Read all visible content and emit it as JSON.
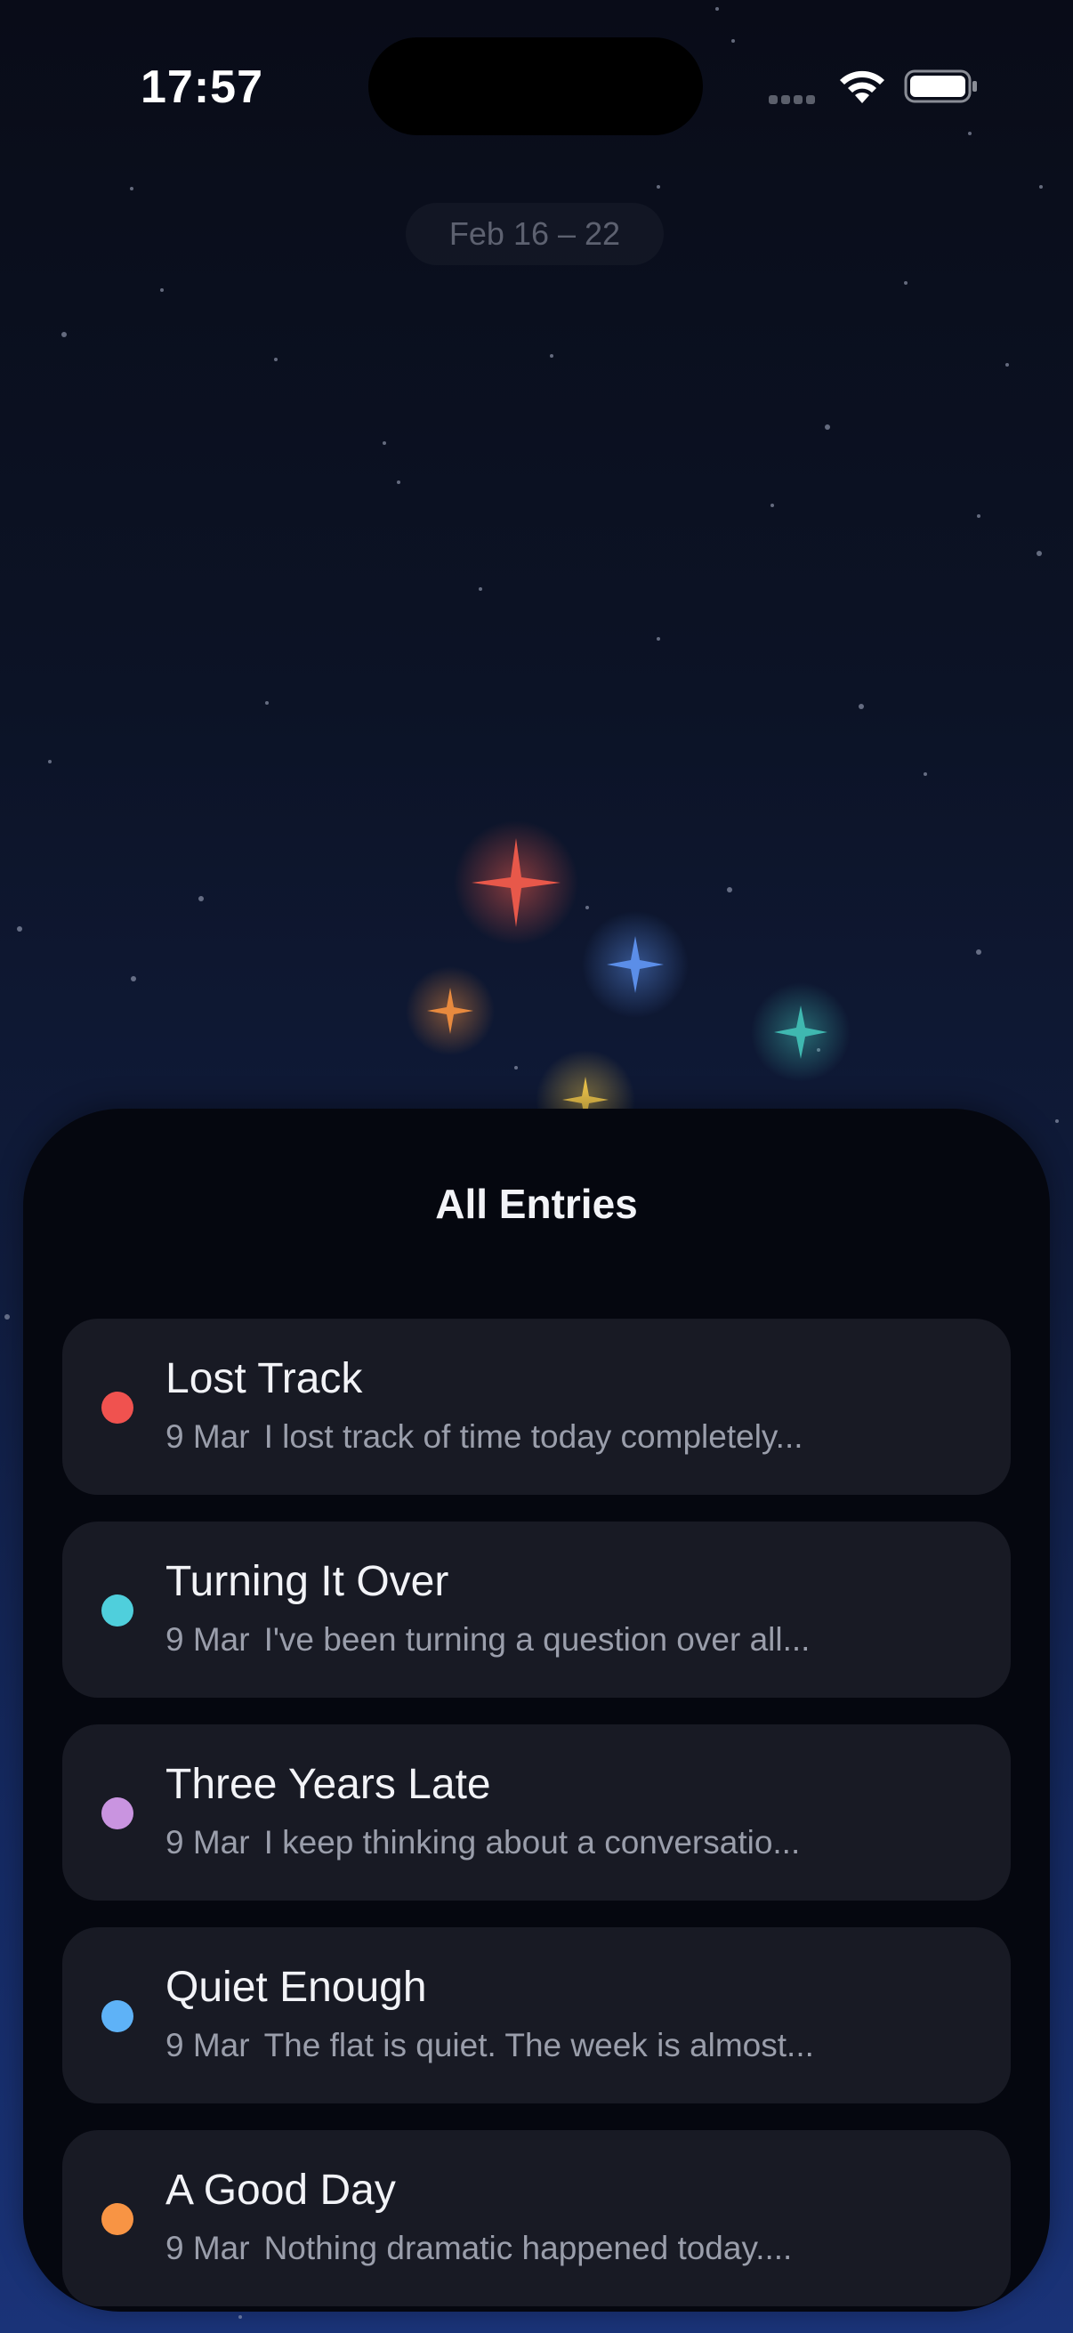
{
  "status_bar": {
    "time": "17:57"
  },
  "header": {
    "week_range": "Feb 16 – 22"
  },
  "sheet": {
    "title": "All Entries",
    "entries": [
      {
        "title": "Lost Track",
        "date": "9 Mar",
        "preview": "I lost track of time today completely...",
        "color": "#f0524f"
      },
      {
        "title": "Turning It Over",
        "date": "9 Mar",
        "preview": "I've been turning a question over all...",
        "color": "#4fcfdc"
      },
      {
        "title": "Three Years Late",
        "date": "9 Mar",
        "preview": "I keep thinking about a conversatio...",
        "color": "#c994e0"
      },
      {
        "title": "Quiet Enough",
        "date": "9 Mar",
        "preview": "The flat is quiet. The week is almost...",
        "color": "#5eb2f7"
      },
      {
        "title": "A Good Day",
        "date": "9 Mar",
        "preview": "Nothing dramatic happened today....",
        "color": "#f89444"
      }
    ]
  },
  "sky": {
    "highlight_stars": [
      {
        "name": "red-star-icon",
        "color": "#e8584a"
      },
      {
        "name": "blue-star-icon",
        "color": "#5b8ee8"
      },
      {
        "name": "orange-star-icon",
        "color": "#e88a3e"
      },
      {
        "name": "teal-star-icon",
        "color": "#3fb8b0"
      },
      {
        "name": "yellow-star-icon",
        "color": "#e8c04a"
      }
    ]
  }
}
